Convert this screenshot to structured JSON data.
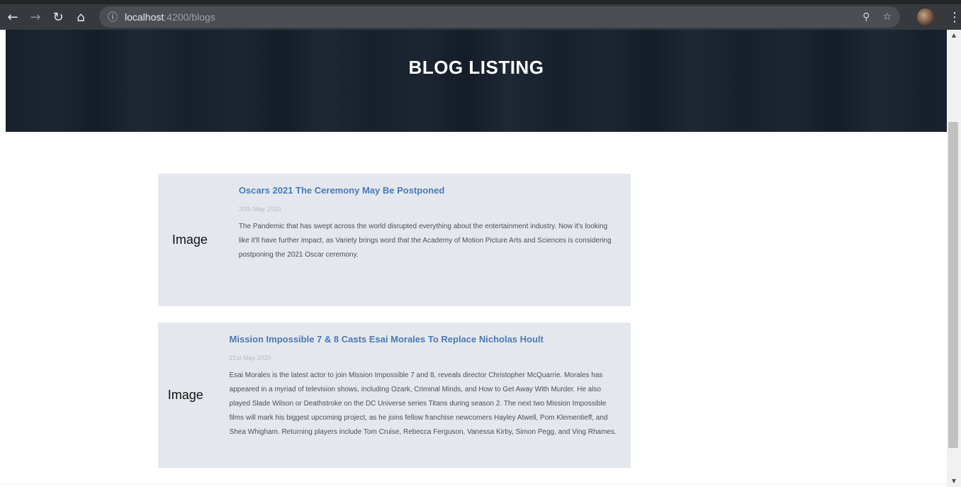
{
  "browser": {
    "url_host": "localhost",
    "url_path": ":4200/blogs"
  },
  "hero": {
    "title": "BLOG LISTING"
  },
  "posts": [
    {
      "image_label": "Image",
      "title": "Oscars 2021 The Ceremony May Be Postponed",
      "date": "20th May 2020",
      "excerpt": "The Pandemic that has swept across the world disrupted everything about the entertainment industry. Now it's looking like it'll have further impact, as Variety brings word that the Academy of Motion Picture Arts and Sciences is considering postponing the 2021 Oscar ceremony."
    },
    {
      "image_label": "Image",
      "title": "Mission Impossible 7 & 8 Casts Esai Morales To Replace Nicholas Hoult",
      "date": "21st May 2020",
      "excerpt": "Esai Morales is the latest actor to join Mission Impossible 7 and 8, reveals director Christopher McQuarrie. Morales has appeared in a myriad of television shows, including Ozark, Criminal Minds, and How to Get Away With Murder. He also played Slade Wilson or Deathstroke on the DC Universe series Titans during season 2. The next two Mission Impossible films will mark his biggest upcoming project, as he joins fellow franchise newcomers Hayley Atwell, Pom Klementieff, and Shea Whigham. Returning players include Tom Cruise, Rebecca Ferguson, Vanessa Kirby, Simon Pegg, and Ving Rhames."
    }
  ]
}
